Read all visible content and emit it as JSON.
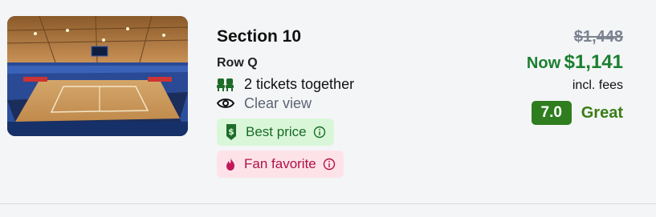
{
  "listing": {
    "section": "Section 10",
    "row": "Row Q",
    "features": {
      "tickets": "2 tickets together",
      "view": "Clear view"
    },
    "badges": {
      "best_price": "Best price",
      "fan_favorite": "Fan favorite"
    },
    "price": {
      "original": "$1,448",
      "now_label": "Now",
      "now_value": "$1,141",
      "fees_note": "incl. fees"
    },
    "rating": {
      "score": "7.0",
      "label": "Great"
    }
  },
  "colors": {
    "now_price": "#1a7f2e",
    "score_bg": "#2f7d1f",
    "best_price_bg": "#d9f7d8",
    "fan_favorite_bg": "#fde3e8"
  },
  "icons": {
    "tickets": "seat-icon",
    "view": "eye-icon",
    "best_price": "price-tag-icon",
    "fan_favorite": "flame-icon",
    "info": "info-icon"
  }
}
